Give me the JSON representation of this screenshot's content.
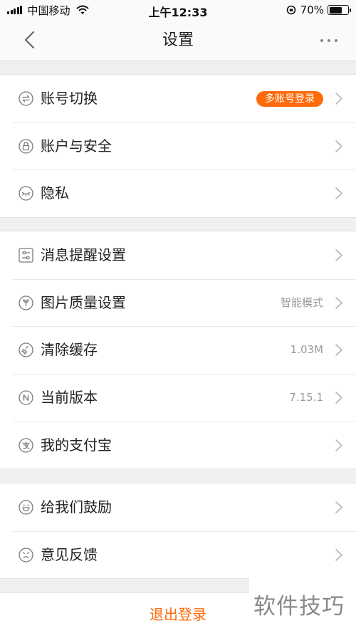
{
  "status_bar": {
    "carrier": "中国移动",
    "time": "上午12:33",
    "battery_pct": "70%",
    "battery_level": 0.7
  },
  "nav": {
    "title": "设置",
    "back_icon": "chevron-left-icon",
    "more_icon": "ellipsis-icon"
  },
  "groups": [
    {
      "items": [
        {
          "label": "账号切换",
          "icon": "switch-account-icon",
          "badge": "多账号登录"
        },
        {
          "label": "账户与安全",
          "icon": "lock-icon"
        },
        {
          "label": "隐私",
          "icon": "closed-eye-icon"
        }
      ]
    },
    {
      "items": [
        {
          "label": "消息提醒设置",
          "icon": "sliders-icon"
        },
        {
          "label": "图片质量设置",
          "icon": "image-quality-icon",
          "value": "智能模式"
        },
        {
          "label": "清除缓存",
          "icon": "broom-icon",
          "value": "1.03M"
        },
        {
          "label": "当前版本",
          "icon": "version-n-icon",
          "value": "7.15.1"
        },
        {
          "label": "我的支付宝",
          "icon": "alipay-icon"
        }
      ]
    },
    {
      "items": [
        {
          "label": "给我们鼓励",
          "icon": "smile-icon"
        },
        {
          "label": "意见反馈",
          "icon": "frown-icon"
        }
      ]
    }
  ],
  "logout_label": "退出登录",
  "watermark": "软件技巧",
  "colors": {
    "accent": "#ff6a0b",
    "background": "#efefef",
    "icon": "#7a7a7a"
  }
}
